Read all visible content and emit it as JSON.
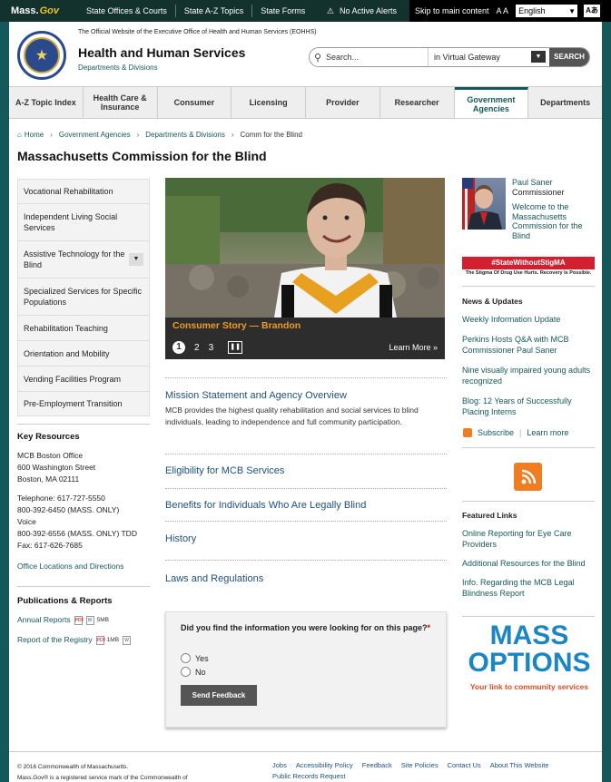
{
  "topbar": {
    "logo_main": "Mass.",
    "logo_gov": "Gov",
    "links": [
      "State Offices & Courts",
      "State A-Z Topics",
      "State Forms"
    ],
    "alerts": "No Active Alerts",
    "skip": "Skip to main content",
    "text_size": "A A",
    "language": "English",
    "translate": "Aあ"
  },
  "header": {
    "official": "The Official Website of the Executive Office of Health and Human Services (EOHHS)",
    "title": "Health and Human Services",
    "subtitle": "Departments & Divisions",
    "search_placeholder": "Search...",
    "search_scope": "in Virtual Gateway",
    "search_button": "SEARCH"
  },
  "nav": [
    {
      "label": "A-Z Topic Index"
    },
    {
      "label": "Health Care & Insurance"
    },
    {
      "label": "Consumer"
    },
    {
      "label": "Licensing"
    },
    {
      "label": "Provider"
    },
    {
      "label": "Researcher"
    },
    {
      "label": "Government Agencies"
    },
    {
      "label": "Departments"
    }
  ],
  "breadcrumb": {
    "home": "Home",
    "items": [
      "Government Agencies",
      "Departments & Divisions",
      "Comm for the Blind"
    ]
  },
  "page_title": "Massachusetts Commission for the Blind",
  "sidenav": [
    {
      "label": "Vocational Rehabilitation"
    },
    {
      "label": "Independent Living Social Services"
    },
    {
      "label": "Assistive Technology for the Blind"
    },
    {
      "label": "Specialized Services for Specific Populations"
    },
    {
      "label": "Rehabilitation Teaching"
    },
    {
      "label": "Orientation and Mobility"
    },
    {
      "label": "Vending Facilities Program"
    },
    {
      "label": "Pre-Employment Transition"
    }
  ],
  "key_resources": {
    "heading": "Key Resources",
    "office": "MCB Boston Office",
    "street": "600 Washington Street",
    "city": "Boston, MA 02111",
    "telephone": "Telephone: 617-727-5550",
    "voice1": "800-392-6450 (MASS. ONLY)",
    "voice2": "Voice",
    "tdd": "800-392-6556 (MASS. ONLY) TDD",
    "fax": "Fax: 617-626-7685",
    "link": "Office Locations and Directions"
  },
  "publications": {
    "heading": "Publications & Reports",
    "annual": "Annual Reports",
    "annual_size": "5MB",
    "registry": "Report of the Registry",
    "registry_size": "1MB"
  },
  "slideshow": {
    "caption": "Consumer Story — Brandon",
    "pages": [
      "1",
      "2",
      "3"
    ],
    "learn_more": "Learn More »"
  },
  "main": {
    "mission_title": "Mission Statement and Agency Overview",
    "mission_desc": "MCB provides the highest quality rehabilitation and social services to blind individuals, leading to independence and full community participation.",
    "eligibility": "Eligibility for MCB Services",
    "benefits": "Benefits for Individuals Who Are Legally Blind",
    "history": "History",
    "laws": "Laws and Regulations"
  },
  "feedback": {
    "question": "Did you find the information you were looking for on this page?",
    "required": "*",
    "yes": "Yes",
    "no": "No",
    "submit": "Send Feedback"
  },
  "right": {
    "name": "Paul Saner",
    "role": "Commissioner",
    "welcome": "Welcome to the Massachusetts Commission for the Blind",
    "stigma_banner": "#StateWithoutStigMA",
    "stigma_sub": "The Stigma Of Drug Use Hurts. Recovery Is Possible.",
    "news_heading": "News & Updates",
    "news": [
      "Weekly Information Update",
      "Perkins Hosts Q&A with MCB Commissioner Paul Saner",
      "Nine visually impaired young adults recognized",
      "Blog: 12 Years of Successfully Placing Interns"
    ],
    "subscribe": "Subscribe",
    "learn_more": "Learn more",
    "featured_heading": "Featured Links",
    "featured": [
      "Online Reporting for Eye Care Providers",
      "Additional Resources for the Blind",
      "Info. Regarding the MCB Legal Blindness Report"
    ],
    "mass_options_1": "MASS",
    "mass_options_2": "OPTIONS",
    "mass_options_tag": "Your link to community services"
  },
  "footer": {
    "copyright": "© 2016 Commonwealth of Massachusetts.",
    "mark": "Mass.Gov® is a registered service mark of the Commonwealth of",
    "links": [
      "Jobs",
      "Accessibility Policy",
      "Feedback",
      "Site Policies",
      "Contact Us",
      "About This Website"
    ],
    "public_records": "Public Records Request"
  },
  "colors": {
    "teal": "#14585a",
    "orange": "#f29a27",
    "link_blue": "#1d4f7e"
  }
}
